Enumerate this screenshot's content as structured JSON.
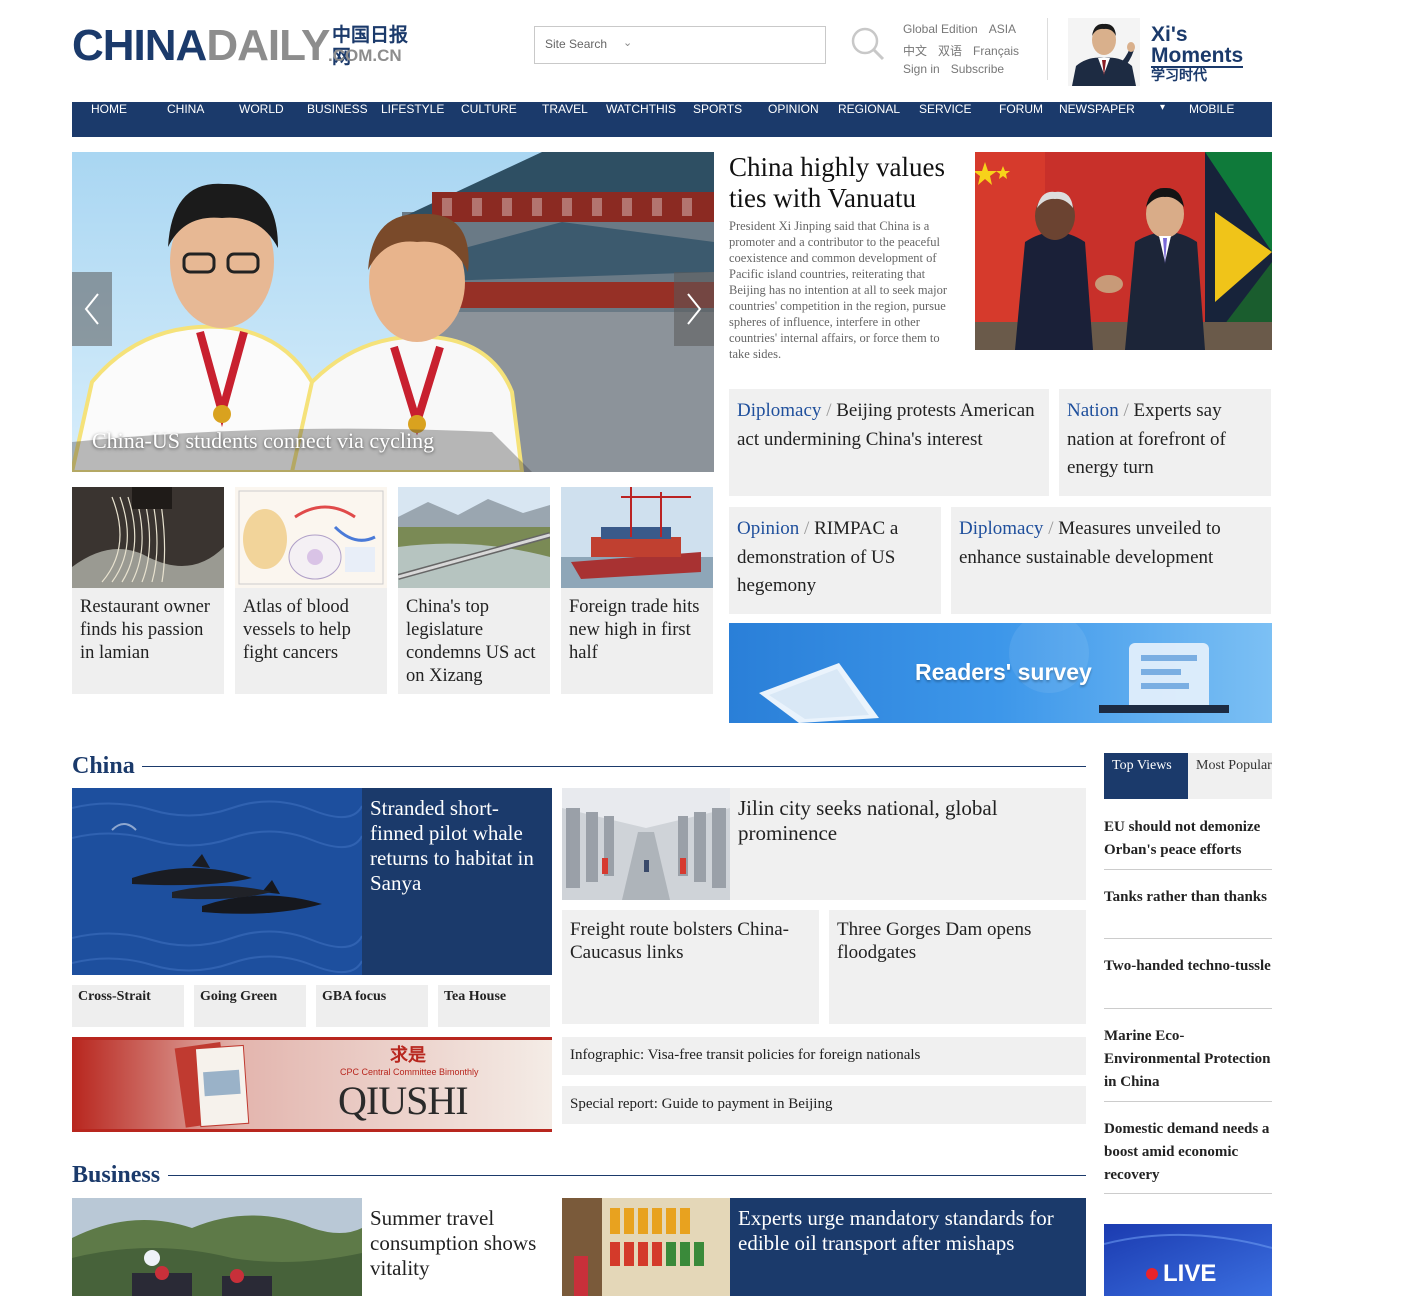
{
  "header": {
    "logo_part1": "CHINA",
    "logo_part2": "DAILY",
    "logo_cn": "中国日报网",
    "logo_domain": ".COM.CN",
    "search_label": "Site Search",
    "search_chevron": "⌄",
    "links_row1": [
      "Global Edition",
      "ASIA"
    ],
    "links_row2": [
      "中文",
      "双语",
      "Français"
    ],
    "links_row3": [
      "Sign in",
      "Subscribe"
    ],
    "xi_line1": "Xi's",
    "xi_line2": "Moments",
    "xi_line3": "学习时代"
  },
  "nav": {
    "items": [
      "HOME",
      "CHINA",
      "WORLD",
      "BUSINESS",
      "LIFESTYLE",
      "CULTURE",
      "TRAVEL",
      "WATCHTHIS",
      "SPORTS",
      "OPINION",
      "REGIONAL",
      "SERVICE",
      "FORUM",
      "NEWSPAPER",
      "MOBILE"
    ],
    "caret": "▾"
  },
  "hero": {
    "caption": "China-US students connect via cycling"
  },
  "lead": {
    "title": "China highly values ties with Vanuatu",
    "summary": "President Xi Jinping said that China is a promoter and a contributor to the peaceful coexistence and common development of Pacific island countries, reiterating that Beijing has no intention at all to seek major countries' competition in the region, pursue spheres of influence, interfere in other countries' internal affairs, or force them to take sides."
  },
  "headline_cards": [
    {
      "category": "Diplomacy",
      "text": "Beijing protests American act undermining China's interest"
    },
    {
      "category": "Nation",
      "text": "Experts say nation at forefront of energy turn"
    },
    {
      "category": "Opinion",
      "text": "RIMPAC a demonstration of US hegemony"
    },
    {
      "category": "Diplomacy",
      "text": "Measures unveiled to enhance sustainable development"
    }
  ],
  "thumb_cards": [
    {
      "title": "Restaurant owner finds his passion in lamian"
    },
    {
      "title": "Atlas of blood vessels to help fight cancers"
    },
    {
      "title": "China's top legislature condemns US act on Xizang"
    },
    {
      "title": "Foreign trade hits new high in first half"
    }
  ],
  "survey_banner": {
    "text": "Readers' survey"
  },
  "china_section": {
    "heading": "China",
    "feature_title": "Stranded short-finned pilot whale returns to habitat in Sanya",
    "jilin_title": "Jilin city seeks national, global prominence",
    "card_a": "Freight route bolsters China-Caucasus links",
    "card_b": "Three Gorges Dam opens floodgates",
    "tags": [
      "Cross-Strait",
      "Going Green",
      "GBA focus",
      "Tea House"
    ],
    "strip1": "Infographic: Visa-free transit policies for foreign nationals",
    "strip2": "Special report: Guide to payment in Beijing",
    "qiushi_sub": "CPC Central Committee Bimonthly",
    "qiushi_main": "QIUSHI",
    "qiushi_cn": "求是"
  },
  "business_section": {
    "heading": "Business",
    "left_title": "Summer travel consumption shows vitality",
    "right_title": "Experts urge mandatory standards for edible oil transport after mishaps"
  },
  "rail": {
    "tab_top": "Top Views",
    "tab_popular": "Most Popular",
    "items": [
      "EU should not demonize Orban's peace efforts",
      "Tanks rather than thanks",
      "Two-handed techno-tussle",
      "Marine Eco-Environmental Protection in China",
      "Domestic demand needs a boost amid economic recovery"
    ],
    "live_label": "LIVE"
  },
  "colors": {
    "brand_navy": "#1b3a6b",
    "category_blue": "#1f4f9c",
    "card_gray": "#f0f0f0"
  }
}
